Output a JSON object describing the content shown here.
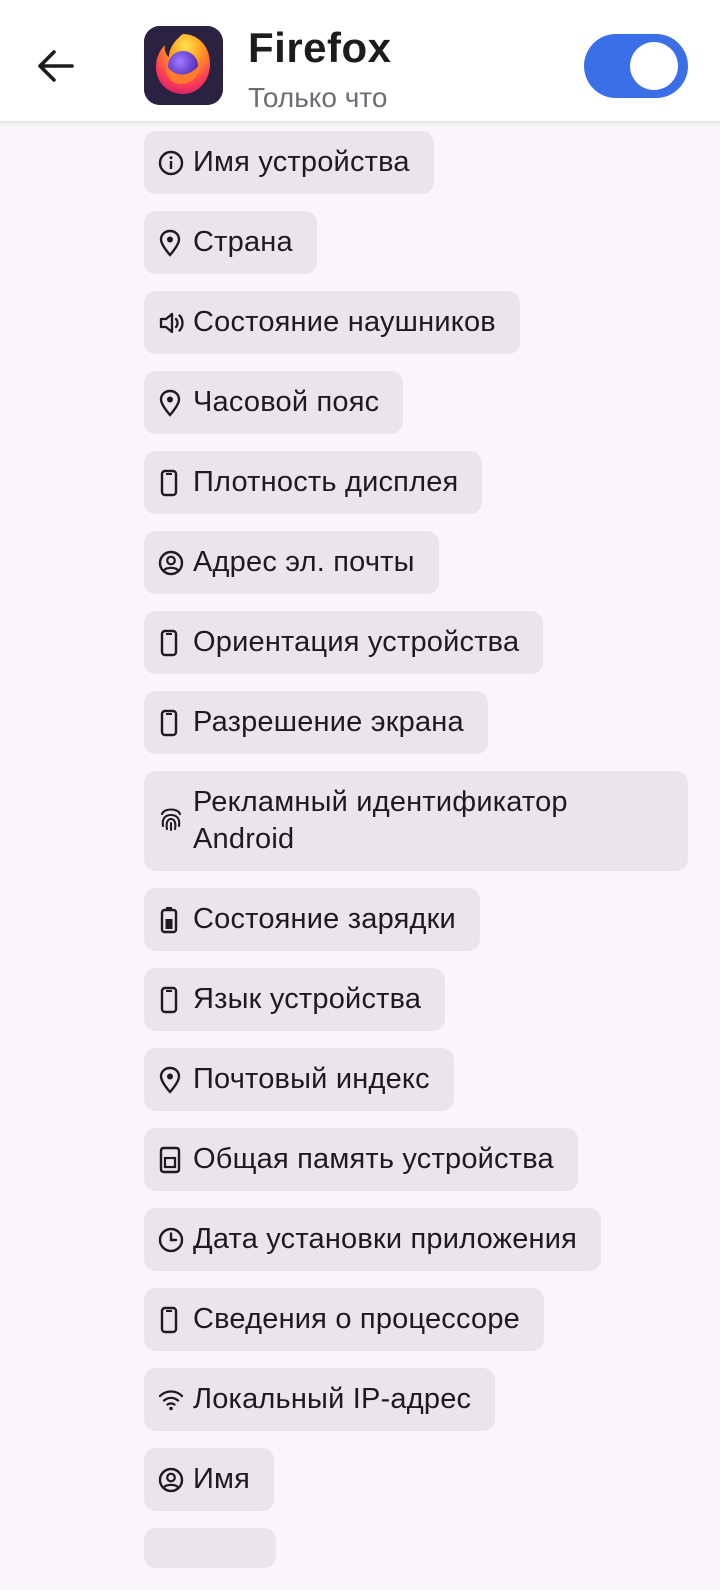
{
  "header": {
    "title": "Firefox",
    "subtitle": "Только что",
    "toggle_on": true,
    "accent_color": "#3b6fe8",
    "icons": {
      "back": "arrow-left-icon",
      "app": "firefox-logo-icon"
    }
  },
  "items": [
    {
      "label": "Имя устройства",
      "icon": "info-icon"
    },
    {
      "label": "Страна",
      "icon": "location-pin-icon"
    },
    {
      "label": "Состояние наушников",
      "icon": "speaker-icon"
    },
    {
      "label": "Часовой пояс",
      "icon": "location-pin-icon"
    },
    {
      "label": "Плотность дисплея",
      "icon": "phone-icon"
    },
    {
      "label": "Адрес эл. почты",
      "icon": "account-circle-icon"
    },
    {
      "label": "Ориентация устройства",
      "icon": "phone-icon"
    },
    {
      "label": "Разрешение экрана",
      "icon": "phone-icon"
    },
    {
      "label": "Рекламный идентификатор Android",
      "icon": "fingerprint-icon"
    },
    {
      "label": "Состояние зарядки",
      "icon": "battery-icon"
    },
    {
      "label": "Язык устройства",
      "icon": "phone-icon"
    },
    {
      "label": "Почтовый индекс",
      "icon": "location-pin-icon"
    },
    {
      "label": "Общая память устройства",
      "icon": "storage-icon"
    },
    {
      "label": "Дата установки приложения",
      "icon": "clock-icon"
    },
    {
      "label": "Сведения о процессоре",
      "icon": "phone-icon"
    },
    {
      "label": "Локальный IP-адрес",
      "icon": "wifi-icon"
    },
    {
      "label": "Имя",
      "icon": "account-circle-icon"
    }
  ]
}
